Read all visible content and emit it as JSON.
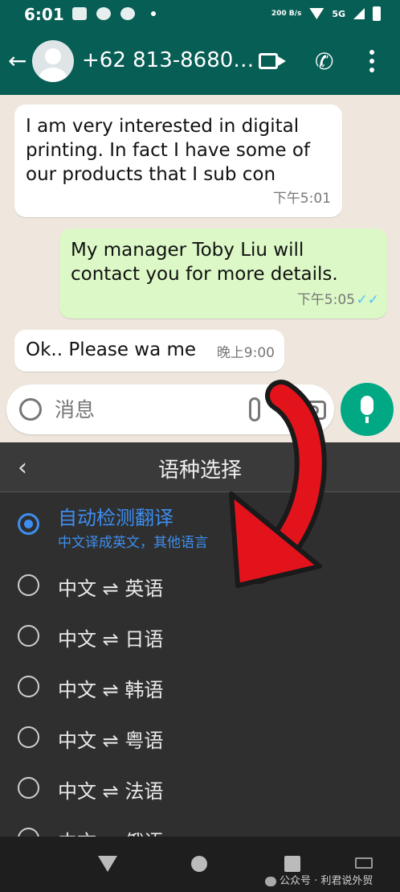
{
  "status_bar": {
    "time": "6:01",
    "net_speed": "200 B/s",
    "network": "5G"
  },
  "header": {
    "contact": "+62 813-8680…"
  },
  "messages": [
    {
      "direction": "incoming",
      "text": "I am very interested in digital printing. In fact I have some of our products that I sub con",
      "time": "下午5:01"
    },
    {
      "direction": "outgoing",
      "text": "My manager Toby Liu will contact you for more details.",
      "time": "下午5:05",
      "status": "read"
    },
    {
      "direction": "incoming",
      "text": "Ok.. Please wa me",
      "time": "晚上9:00"
    }
  ],
  "composer": {
    "placeholder": "消息"
  },
  "language_panel": {
    "title": "语种选择",
    "options": [
      {
        "label": "自动检测翻译",
        "sub": "中文译成英文，其他语言",
        "selected": true
      },
      {
        "label": "中文 ⇌ 英语",
        "selected": false
      },
      {
        "label": "中文 ⇌ 日语",
        "selected": false
      },
      {
        "label": "中文 ⇌ 韩语",
        "selected": false
      },
      {
        "label": "中文 ⇌ 粤语",
        "selected": false
      },
      {
        "label": "中文 ⇌ 法语",
        "selected": false
      },
      {
        "label": "中文 ⇌ 俄语",
        "selected": false
      }
    ]
  },
  "watermark": "公众号 · 利君说外贸",
  "colors": {
    "header": "#075e54",
    "accent": "#3d8ef0",
    "mic": "#00a884",
    "arrow": "#e3131c"
  }
}
